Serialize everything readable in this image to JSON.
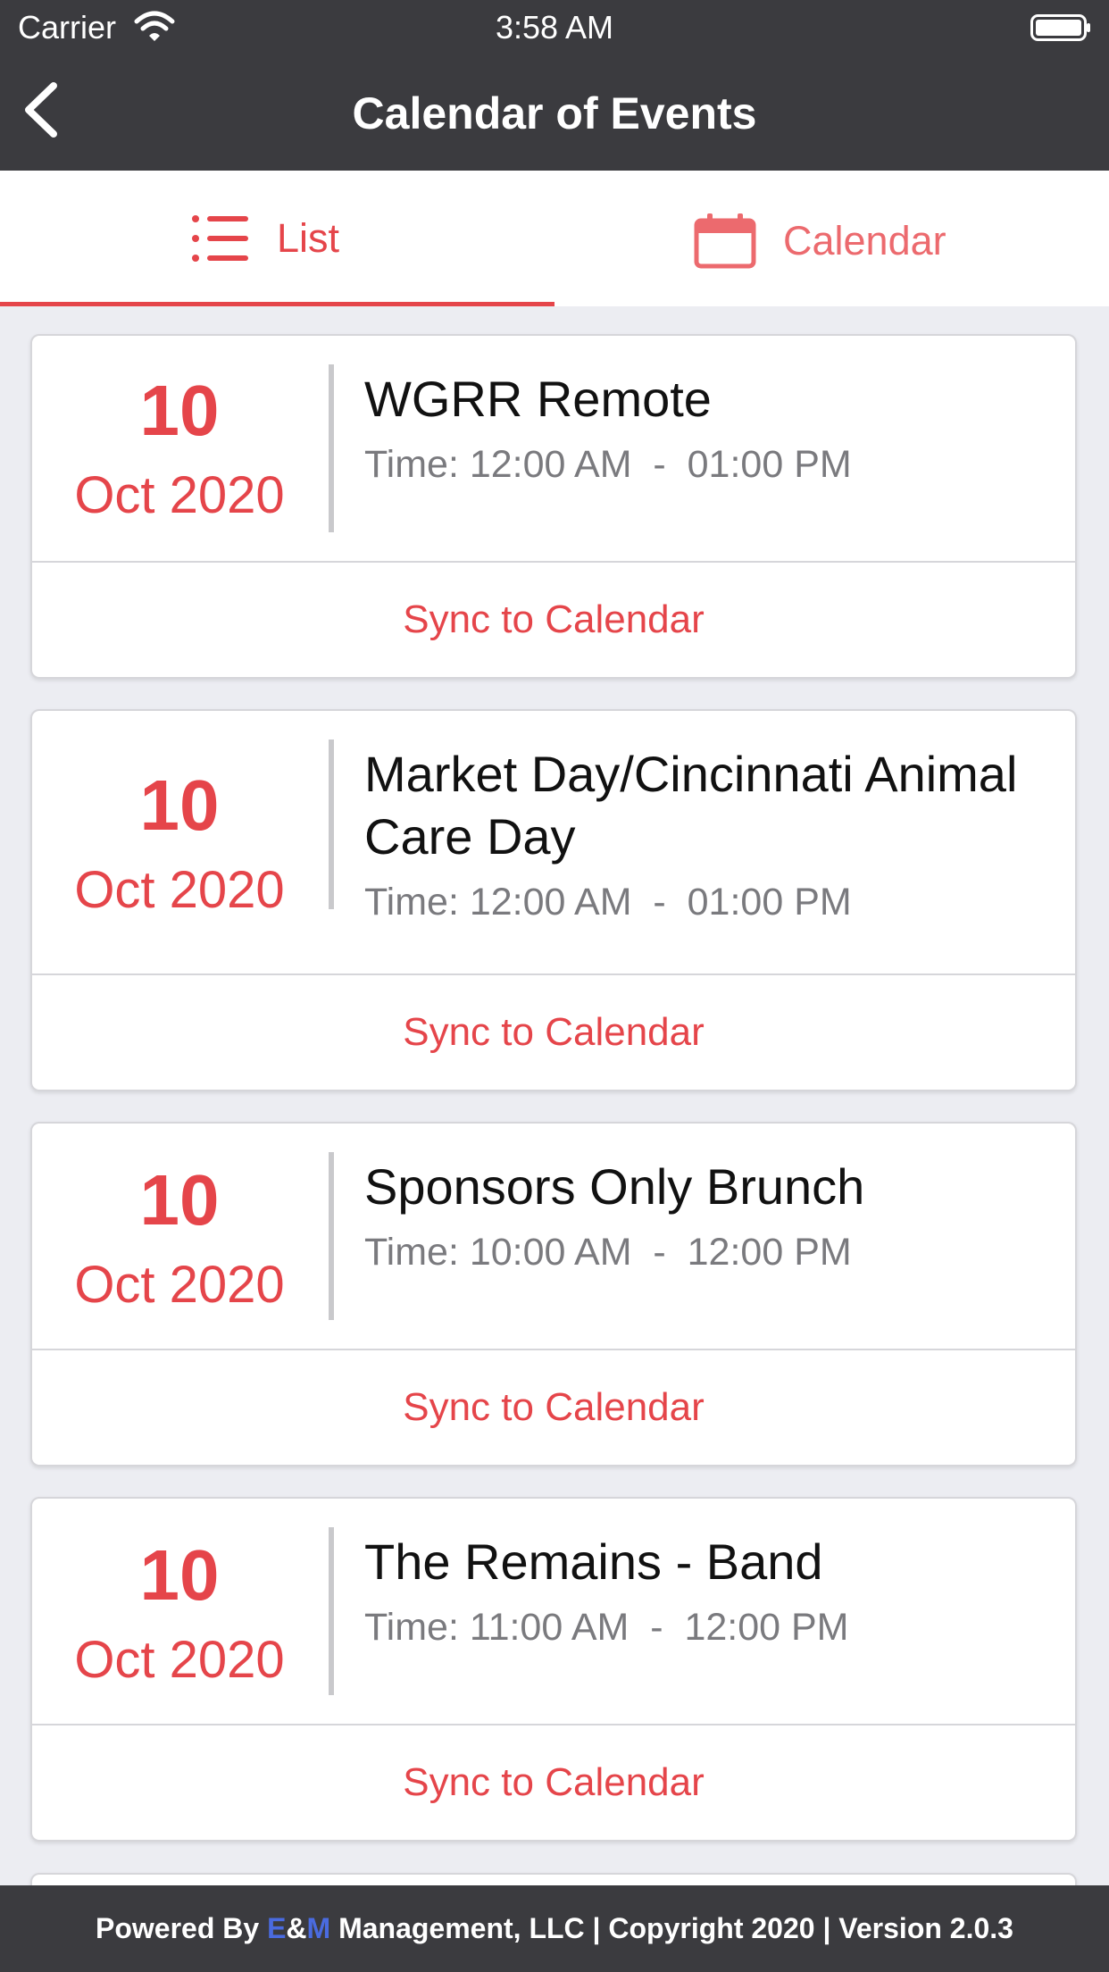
{
  "status_bar": {
    "carrier": "Carrier",
    "time": "3:58 AM"
  },
  "nav": {
    "title": "Calendar of Events"
  },
  "tabs": [
    {
      "label": "List",
      "icon": "list-icon",
      "active": true
    },
    {
      "label": "Calendar",
      "icon": "calendar-icon",
      "active": false
    }
  ],
  "events": [
    {
      "day": "10",
      "month": "Oct 2020",
      "title": "WGRR Remote",
      "time": "Time: 12:00 AM  -  01:00 PM",
      "sync_label": "Sync to Calendar"
    },
    {
      "day": "10",
      "month": "Oct 2020",
      "title": "Market Day/Cincinnati Animal Care Day",
      "time": "Time: 12:00 AM  -  01:00 PM",
      "sync_label": "Sync to Calendar"
    },
    {
      "day": "10",
      "month": "Oct 2020",
      "title": "Sponsors Only Brunch",
      "time": "Time: 10:00 AM  -  12:00 PM",
      "sync_label": "Sync to Calendar"
    },
    {
      "day": "10",
      "month": "Oct 2020",
      "title": "The Remains - Band",
      "time": "Time: 11:00 AM  -  12:00 PM",
      "sync_label": "Sync to Calendar"
    }
  ],
  "footer": {
    "prefix": "Powered By ",
    "brand_e": "E",
    "brand_amp": "&",
    "brand_m": "M",
    "suffix": " Management, LLC | Copyright 2020 | Version 2.0.3"
  },
  "colors": {
    "accent": "#e5454a",
    "bar": "#3b3b3f",
    "background": "#ecedf2",
    "brand_blue": "#4a6be0"
  }
}
